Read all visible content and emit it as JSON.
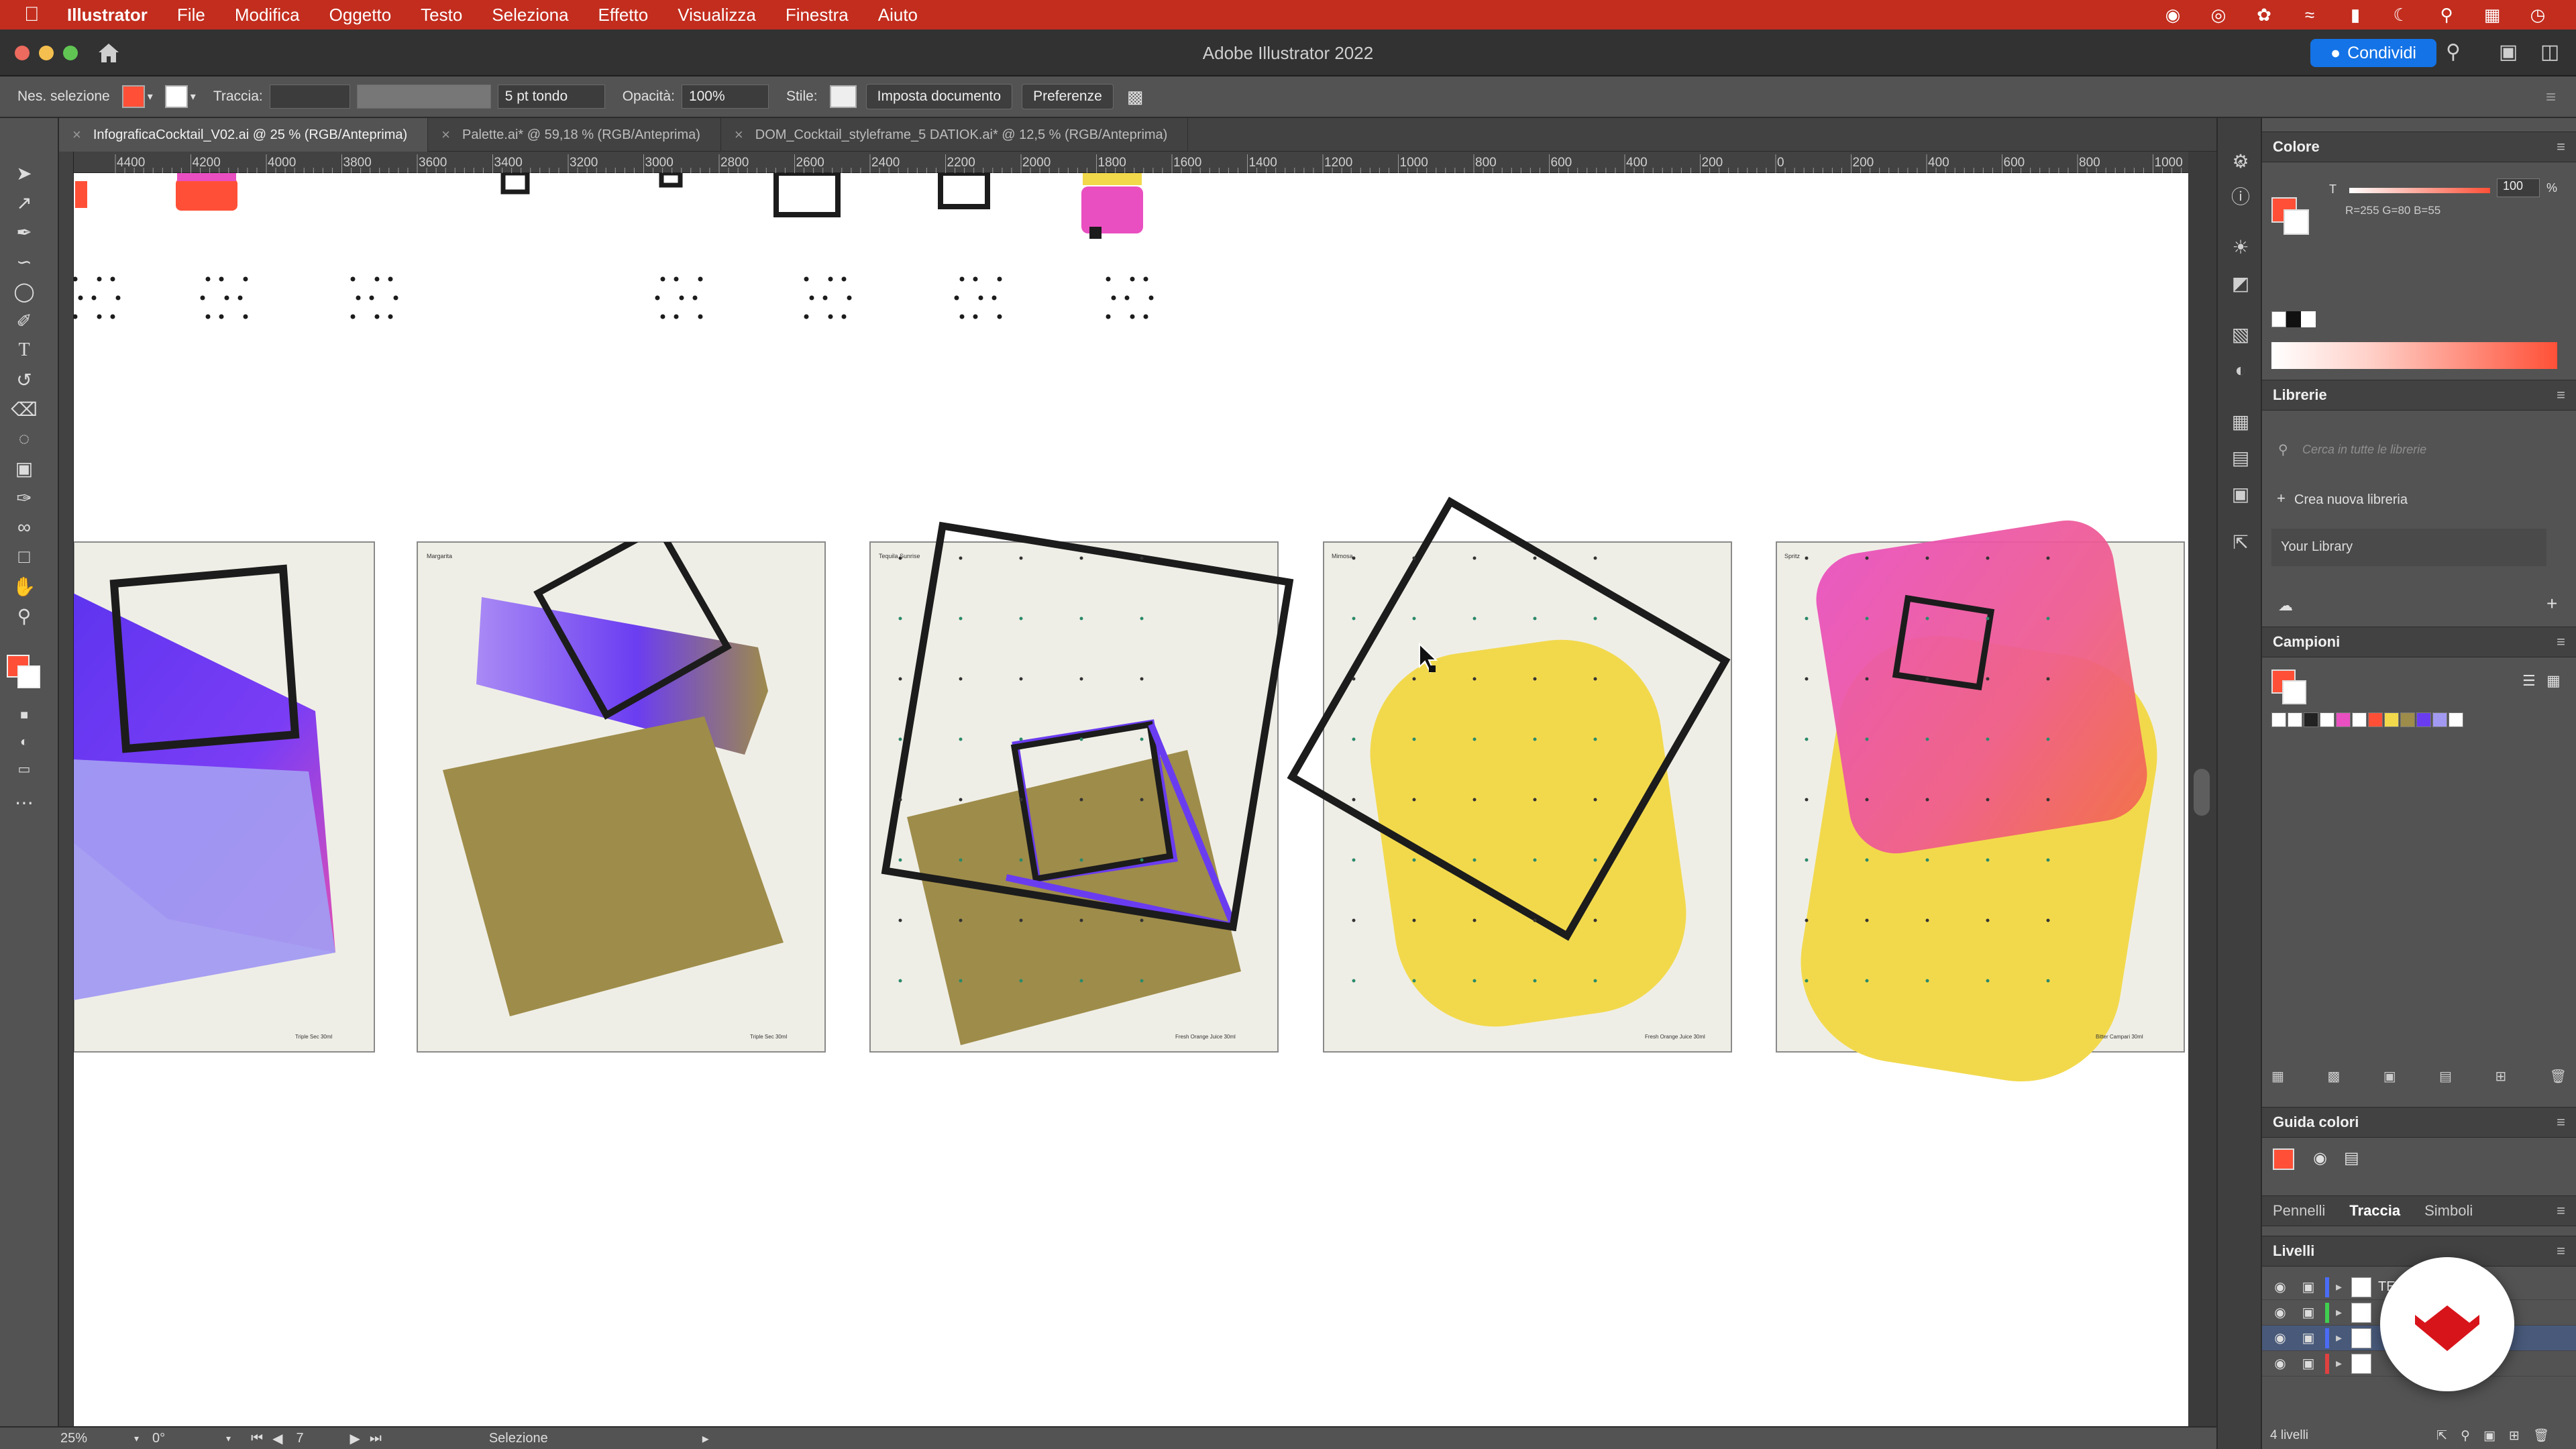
{
  "menubar": {
    "app": "Illustrator",
    "items": [
      "File",
      "Modifica",
      "Oggetto",
      "Testo",
      "Seleziona",
      "Effetto",
      "Visualizza",
      "Finestra",
      "Aiuto"
    ]
  },
  "window": {
    "title": "Adobe Illustrator 2022",
    "share_label": "Condividi"
  },
  "control_bar": {
    "selection": "Nes. selezione",
    "stroke_label": "Traccia:",
    "brush": "5 pt tondo",
    "opacity_label": "Opacità:",
    "opacity_value": "100%",
    "style_label": "Stile:",
    "doc_setup": "Imposta documento",
    "preferences": "Preferenze"
  },
  "tabs": [
    {
      "label": "InfograficaCocktail_V02.ai @ 25 % (RGB/Anteprima)",
      "active": true
    },
    {
      "label": "Palette.ai* @ 59,18 % (RGB/Anteprima)",
      "active": false
    },
    {
      "label": "DOM_Cocktail_styleframe_5 DATIOK.ai* @ 12,5 % (RGB/Anteprima)",
      "active": false
    }
  ],
  "ruler": {
    "labels": [
      "4400",
      "4200",
      "4000",
      "3800",
      "3600",
      "3400",
      "3200",
      "3000",
      "2800",
      "2600",
      "2400",
      "2200",
      "2000",
      "1800",
      "1600",
      "1400",
      "1200",
      "1000",
      "800",
      "600",
      "400",
      "200",
      "0",
      "200",
      "400",
      "600",
      "800",
      "1000"
    ]
  },
  "artboards": [
    {
      "name": "",
      "footer": "Triple Sec  30ml"
    },
    {
      "name": "Margarita",
      "footer": "Triple Sec  30ml"
    },
    {
      "name": "Tequila Sunrise",
      "footer": "Fresh Orange Juice  30ml"
    },
    {
      "name": "Mimosa",
      "footer": "Fresh Orange Juice  30ml"
    },
    {
      "name": "Spritz",
      "footer": "Bitter Campari  30ml"
    }
  ],
  "status_bar": {
    "zoom": "25%",
    "rotation": "0°",
    "artboard": "7",
    "tool": "Selezione"
  },
  "panels": {
    "color": {
      "title": "Colore",
      "t_label": "T",
      "tint_value": "100",
      "tint_unit": "%",
      "rgb": "R=255 G=80 B=55"
    },
    "libraries": {
      "title": "Librerie",
      "search_placeholder": "Cerca in tutte le librerie",
      "create": "Crea nuova libreria",
      "library_name": "Your Library"
    },
    "swatches": {
      "title": "Campioni"
    },
    "color_guide": {
      "title": "Guida colori"
    },
    "tabs": [
      "Pennelli",
      "Traccia",
      "Simboli"
    ],
    "layers": {
      "title": "Livelli",
      "count": "4 livelli",
      "rows": [
        {
          "color": "#4a6cf7",
          "name": "TE"
        },
        {
          "color": "#3fcf4f",
          "name": ""
        },
        {
          "color": "#4a6cf7",
          "name": ""
        },
        {
          "color": "#e04040",
          "name": ""
        }
      ]
    }
  },
  "colors": {
    "accent": "#c22d1e",
    "fill": "#ff5037",
    "purple": "#6a3cf0",
    "olive": "#9e8c4a",
    "yellow": "#f2d94c",
    "pink": "#e94fc0",
    "artboard_bg": "#efeee6"
  }
}
